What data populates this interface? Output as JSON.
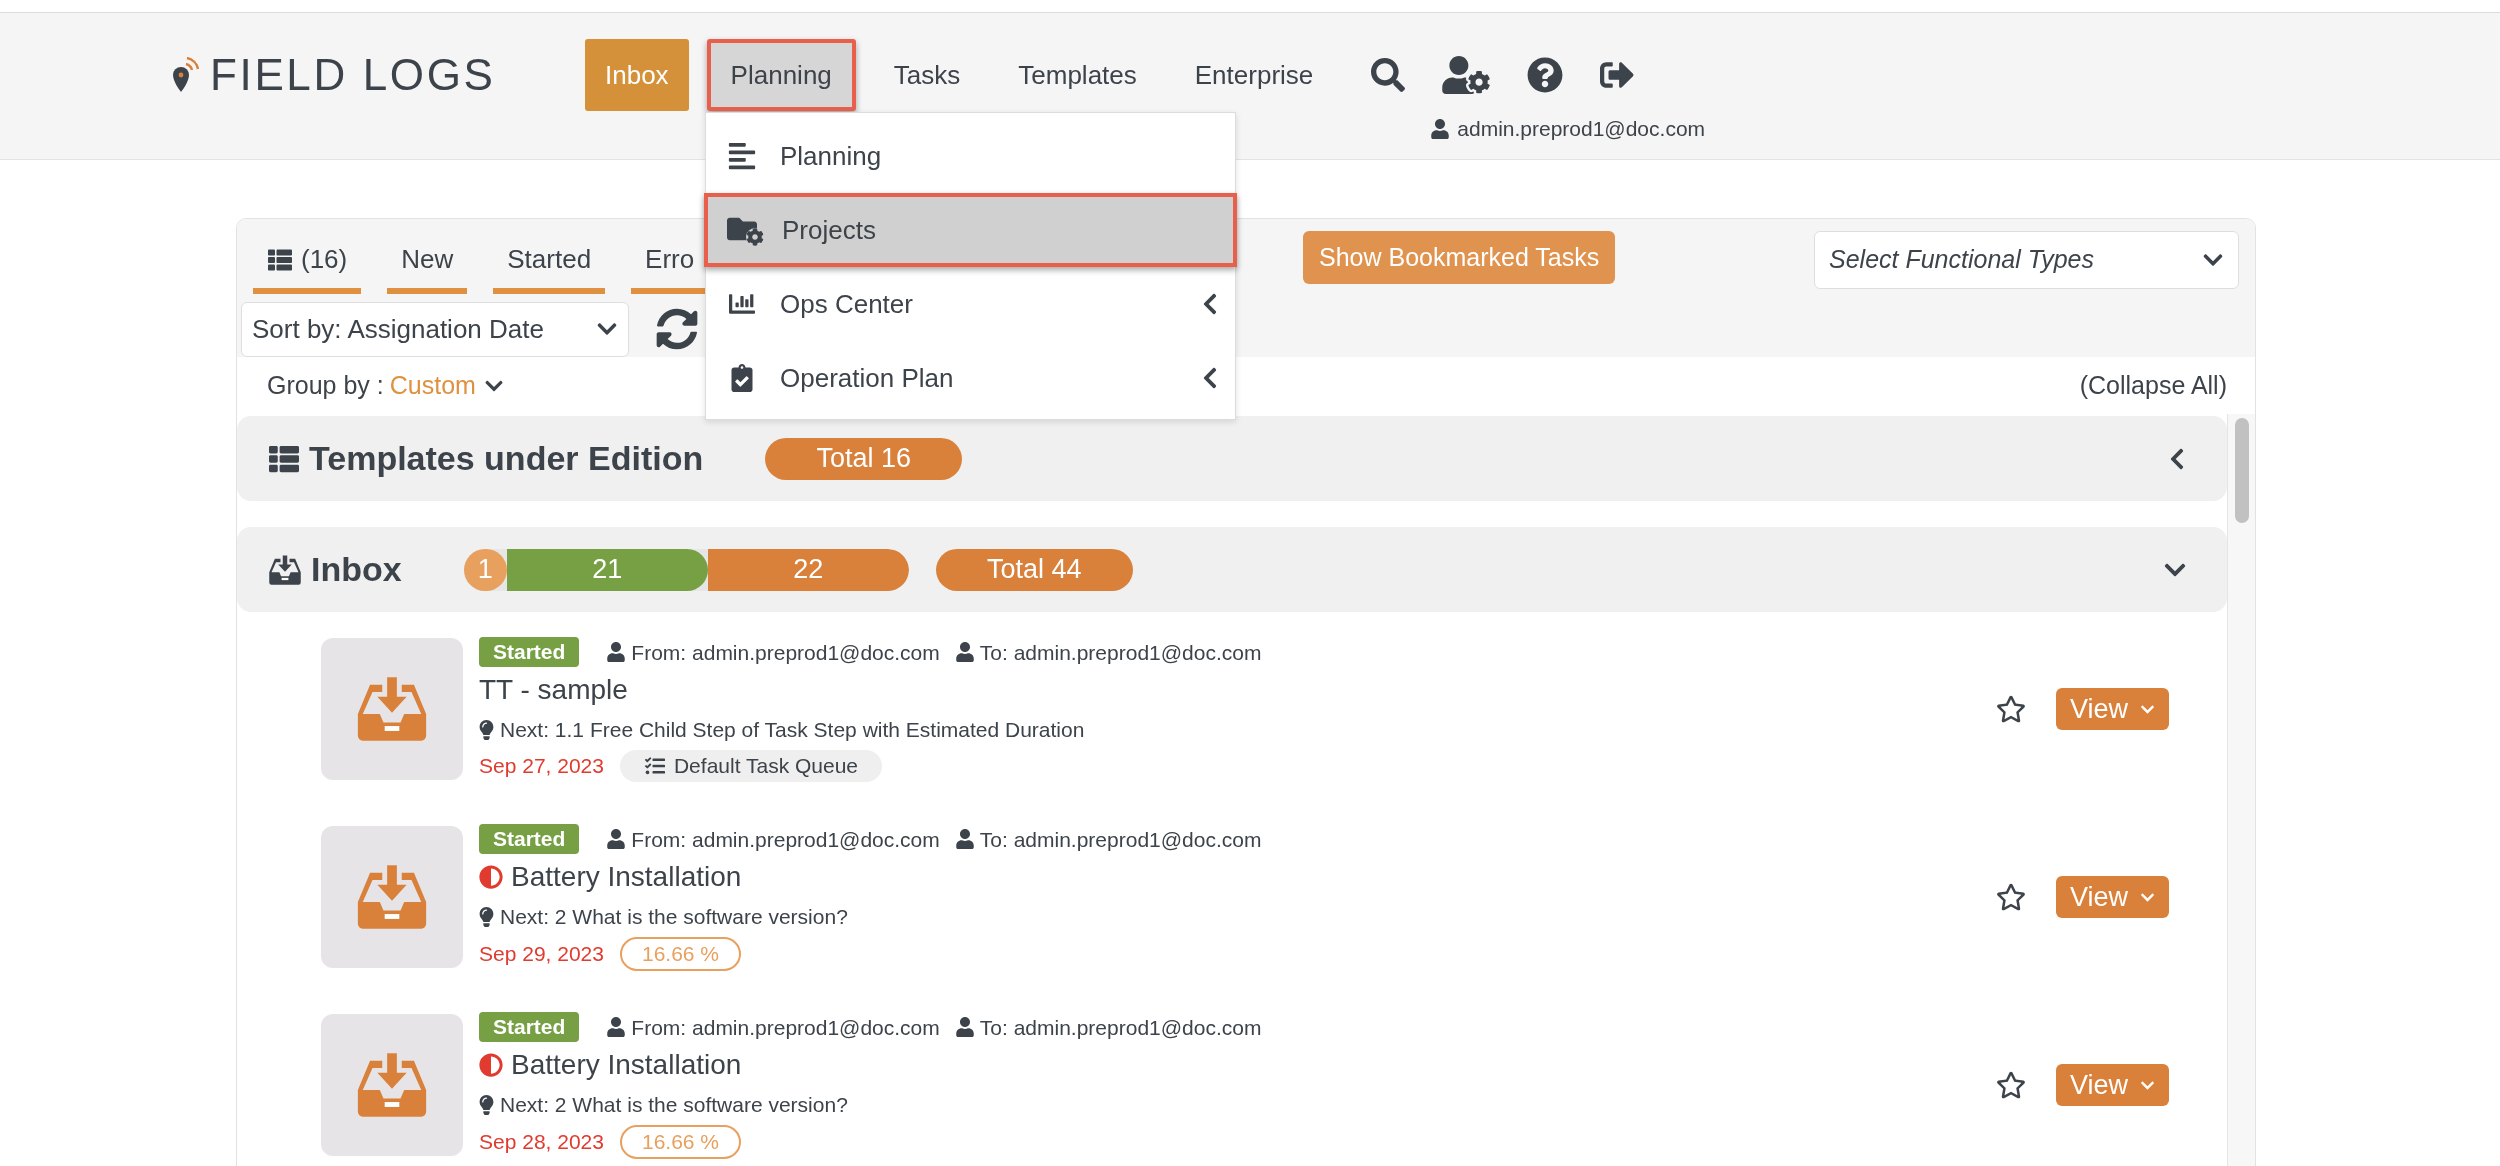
{
  "logo": "FIELD LOGS",
  "nav": [
    {
      "label": "Inbox",
      "selected": true,
      "open": false
    },
    {
      "label": "Planning",
      "selected": false,
      "open": true
    },
    {
      "label": "Tasks",
      "selected": false,
      "open": false
    },
    {
      "label": "Templates",
      "selected": false,
      "open": false
    },
    {
      "label": "Enterprise",
      "selected": false,
      "open": false
    }
  ],
  "user": "admin.preprod1@doc.com",
  "menu": {
    "items": [
      {
        "label": "Planning",
        "highlighted": false,
        "submenu": false
      },
      {
        "label": "Projects",
        "highlighted": true,
        "submenu": false
      },
      {
        "label": "Ops Center",
        "highlighted": false,
        "submenu": true
      },
      {
        "label": "Operation Plan",
        "highlighted": false,
        "submenu": true
      }
    ]
  },
  "filter_tabs": [
    {
      "label": "(16)"
    },
    {
      "label": "New"
    },
    {
      "label": "Started"
    },
    {
      "label": "Erro"
    }
  ],
  "bookmark_button": "Show Bookmarked Tasks",
  "functional_types": {
    "placeholder": "Select Functional Types"
  },
  "sort": {
    "value": "Sort by: Assignation Date"
  },
  "group_by": {
    "label": "Group by :",
    "value": "Custom"
  },
  "collapse_all": "(Collapse All)",
  "sections": [
    {
      "title": "Templates under Edition",
      "expanded": false,
      "total": "Total 16"
    },
    {
      "title": "Inbox",
      "expanded": true,
      "total": "Total 44",
      "segments": [
        {
          "label": "1",
          "color": "#e8a05f"
        },
        {
          "label": "21",
          "color": "#76a043"
        },
        {
          "label": "22",
          "color": "#d9813a"
        }
      ],
      "tasks": [
        {
          "status": {
            "label": "Started",
            "color": "#76a043"
          },
          "from": "From: admin.preprod1@doc.com",
          "to": "To: admin.preprod1@doc.com",
          "title": "TT - sample",
          "warning": false,
          "next": "Next: 1.1 Free Child Step of Task Step with Estimated Duration",
          "date": "Sep 27, 2023",
          "tag": {
            "kind": "queue",
            "label": "Default Task Queue"
          },
          "bookmarked": false,
          "action": "View"
        },
        {
          "status": {
            "label": "Started",
            "color": "#76a043"
          },
          "from": "From: admin.preprod1@doc.com",
          "to": "To: admin.preprod1@doc.com",
          "title": "Battery Installation",
          "warning": true,
          "next": "Next: 2 What is the software version?",
          "date": "Sep 29, 2023",
          "tag": {
            "kind": "progress",
            "label": "16.66 %"
          },
          "bookmarked": false,
          "action": "View"
        },
        {
          "status": {
            "label": "Started",
            "color": "#76a043"
          },
          "from": "From: admin.preprod1@doc.com",
          "to": "To: admin.preprod1@doc.com",
          "title": "Battery Installation",
          "warning": true,
          "next": "Next: 2 What is the software version?",
          "date": "Sep 28, 2023",
          "tag": {
            "kind": "progress",
            "label": "16.66 %"
          },
          "bookmarked": false,
          "action": "View"
        }
      ]
    }
  ]
}
